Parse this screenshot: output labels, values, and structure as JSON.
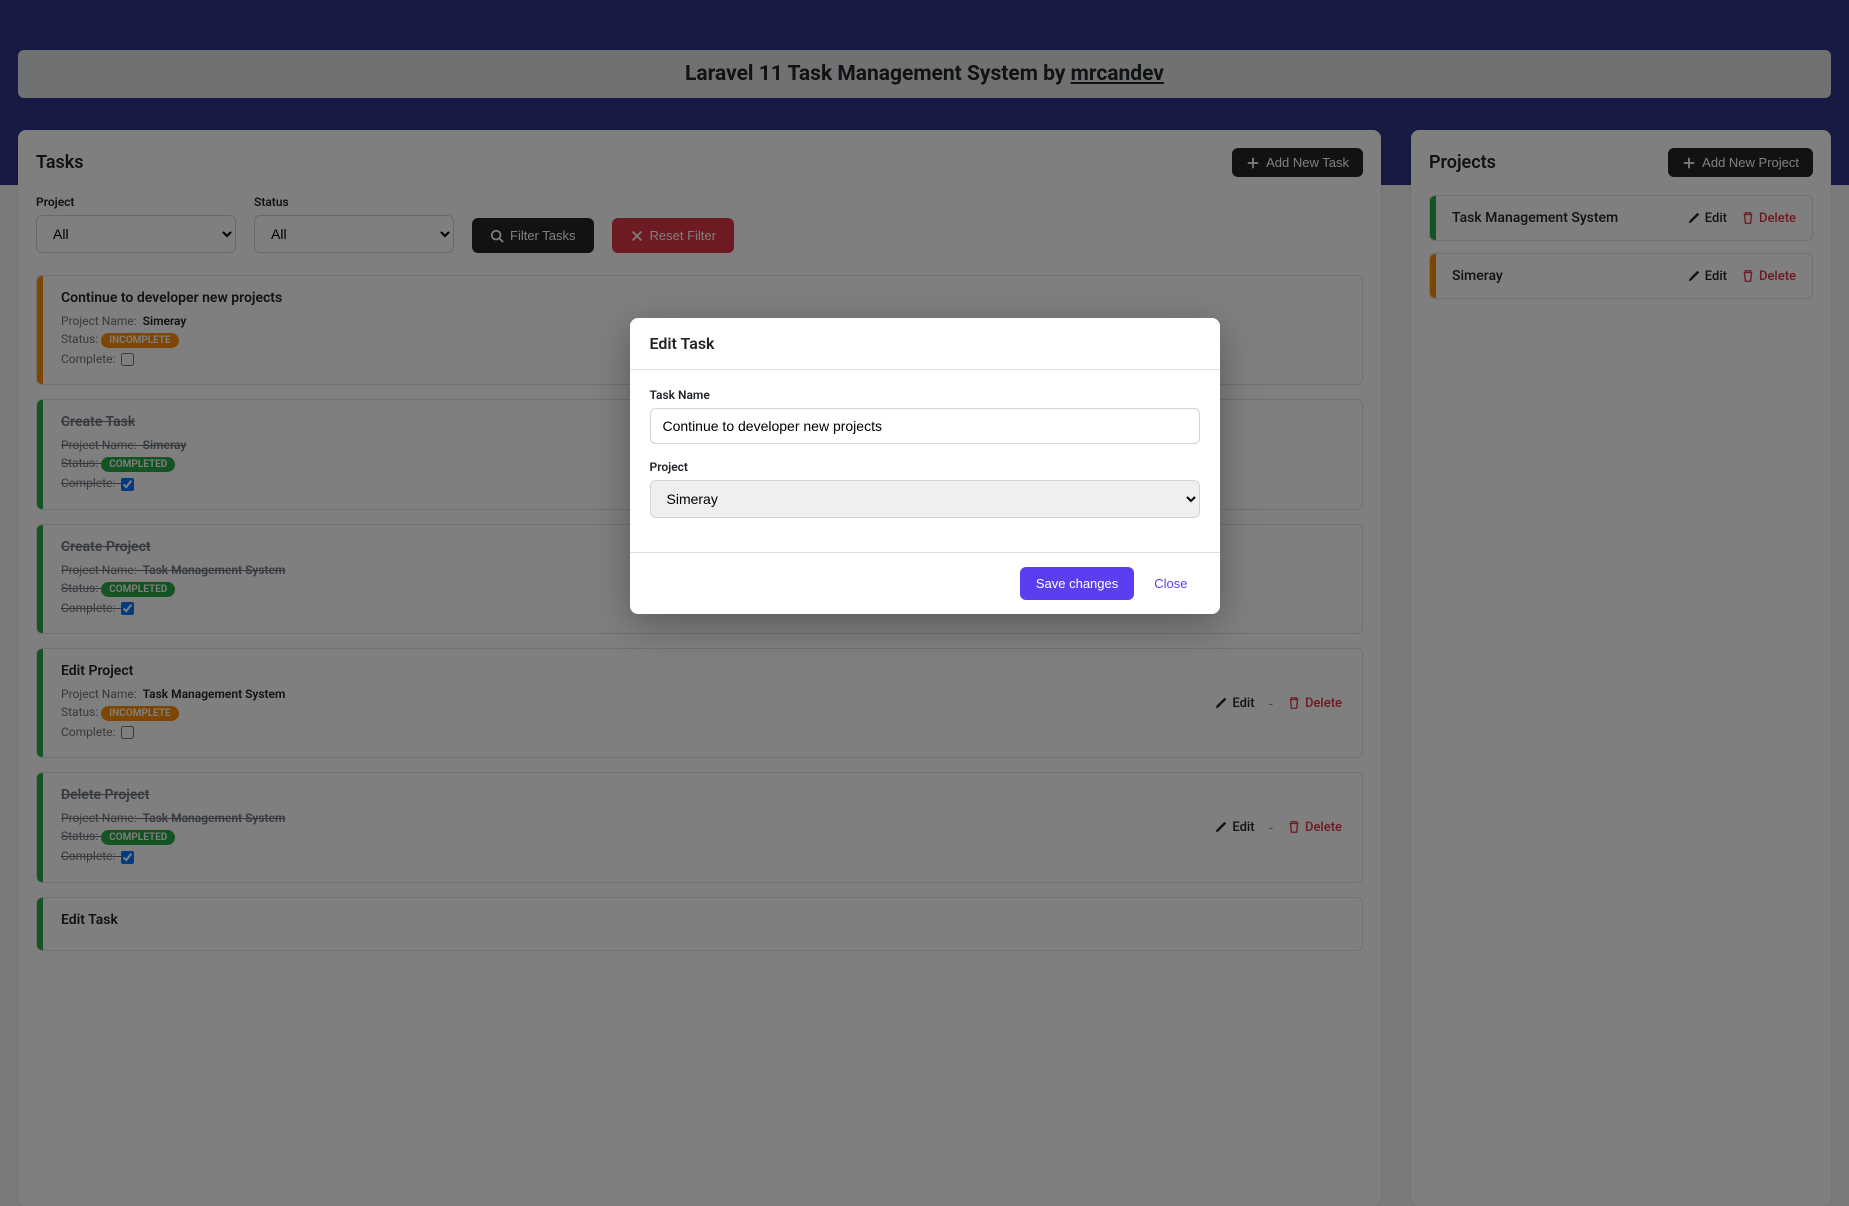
{
  "banner": {
    "title_prefix": "Laravel 11 Task Management System by ",
    "author": "mrcandev"
  },
  "tasksPanel": {
    "title": "Tasks",
    "addButton": "Add New Task",
    "filters": {
      "projectLabel": "Project",
      "projectValue": "All",
      "statusLabel": "Status",
      "statusValue": "All",
      "filterButton": "Filter Tasks",
      "resetButton": "Reset Filter"
    },
    "labels": {
      "projectName": "Project Name:",
      "status": "Status:",
      "complete": "Complete:",
      "edit": "Edit",
      "delete": "Delete",
      "incomplete": "INCOMPLETE",
      "completed": "COMPLETED"
    },
    "tasks": [
      {
        "title": "Continue to developer new projects",
        "project": "Simeray",
        "status": "incomplete",
        "complete": false,
        "stripe": "orange",
        "showActions": false
      },
      {
        "title": "Create Task",
        "project": "Simeray",
        "status": "completed",
        "complete": true,
        "stripe": "green",
        "showActions": false
      },
      {
        "title": "Create Project",
        "project": "Task Management System",
        "status": "completed",
        "complete": true,
        "stripe": "green",
        "showActions": false
      },
      {
        "title": "Edit Project",
        "project": "Task Management System",
        "status": "incomplete",
        "complete": false,
        "stripe": "green",
        "showActions": true
      },
      {
        "title": "Delete Project",
        "project": "Task Management System",
        "status": "completed",
        "complete": true,
        "stripe": "green",
        "showActions": true
      },
      {
        "title": "Edit Task",
        "project": "",
        "status": "",
        "complete": false,
        "stripe": "green",
        "showActions": false
      }
    ]
  },
  "projectsPanel": {
    "title": "Projects",
    "addButton": "Add New Project",
    "labels": {
      "edit": "Edit",
      "delete": "Delete"
    },
    "projects": [
      {
        "name": "Task Management System",
        "stripe": "green"
      },
      {
        "name": "Simeray",
        "stripe": "orange"
      }
    ]
  },
  "modal": {
    "title": "Edit Task",
    "taskNameLabel": "Task Name",
    "taskNameValue": "Continue to developer new projects",
    "projectLabel": "Project",
    "projectValue": "Simeray",
    "saveButton": "Save changes",
    "closeButton": "Close"
  }
}
